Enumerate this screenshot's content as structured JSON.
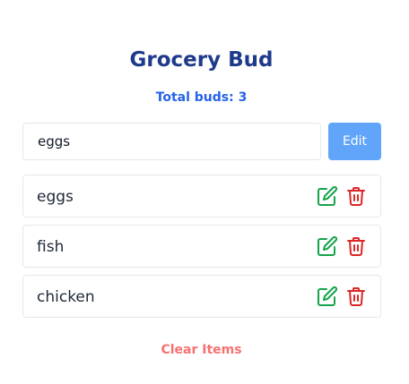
{
  "header": {
    "title": "Grocery Bud",
    "total_label": "Total buds: 3"
  },
  "form": {
    "input_value": "eggs",
    "submit_label": "Edit"
  },
  "items": [
    {
      "name": "eggs",
      "edit_icon": "edit-icon",
      "delete_icon": "trash-icon"
    },
    {
      "name": "fish",
      "edit_icon": "edit-icon",
      "delete_icon": "trash-icon"
    },
    {
      "name": "chicken",
      "edit_icon": "edit-icon",
      "delete_icon": "trash-icon"
    }
  ],
  "footer": {
    "clear_label": "Clear Items"
  },
  "colors": {
    "title": "#1e3a8a",
    "count": "#2563eb",
    "edit_button_bg": "#60a5fa",
    "edit_icon": "#16a34a",
    "delete_icon": "#dc2626",
    "clear_text": "#f87171"
  }
}
